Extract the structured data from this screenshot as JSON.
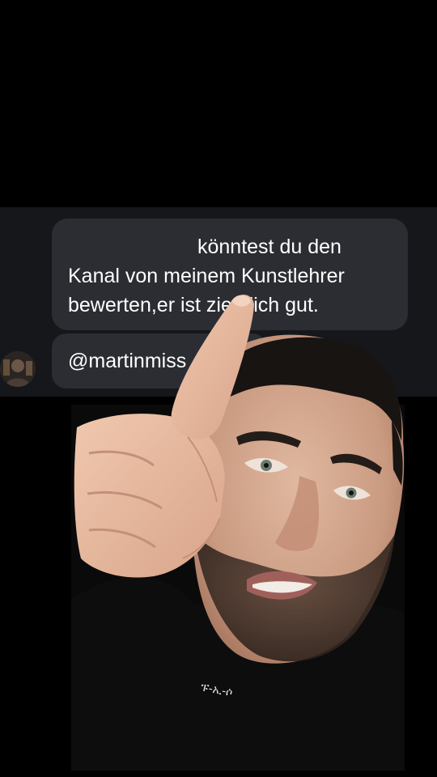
{
  "comment": {
    "line_1": "könntest du den",
    "line_2": "Kanal von meinem Kunstlehrer",
    "line_3": "bewerten,er ist ziemlich gut."
  },
  "mention": {
    "text": "@martinmiss"
  },
  "shirt": {
    "logo_text": "ፑ-ኢ-ሶ"
  },
  "colors": {
    "background": "#000000",
    "chat_strip": "#15171b",
    "bubble": "#2b2d33",
    "text": "#ffffff"
  },
  "icons": {
    "avatar": "avatar"
  }
}
